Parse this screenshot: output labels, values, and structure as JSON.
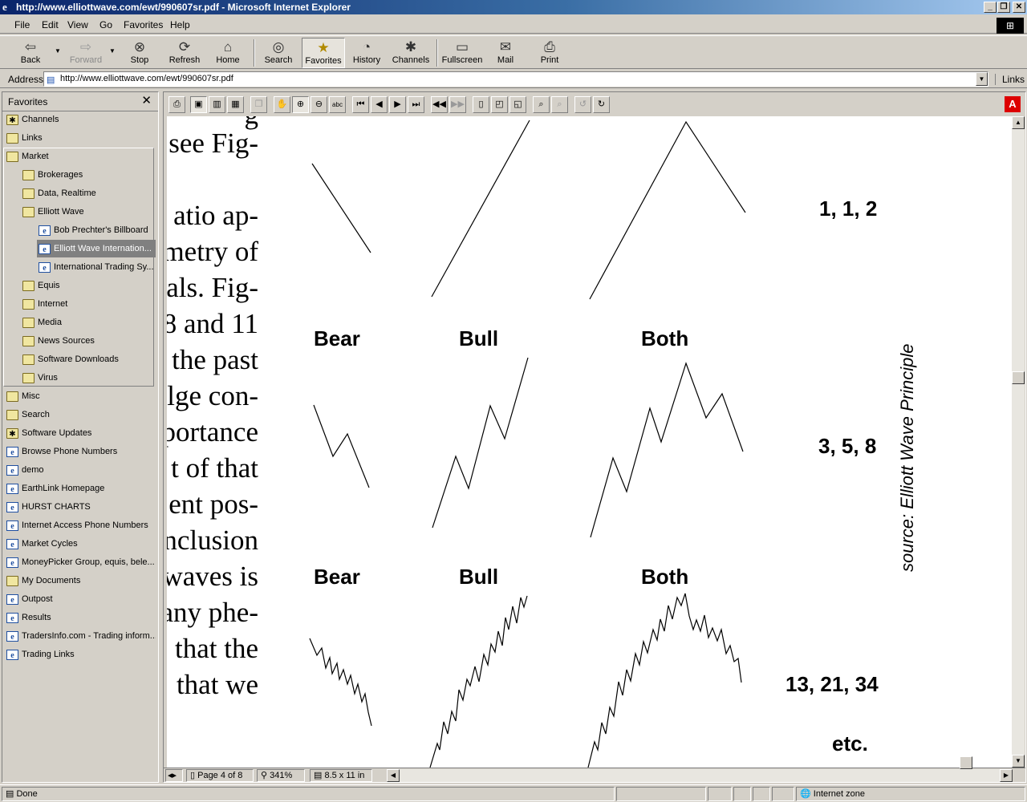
{
  "window": {
    "title": "http://www.elliottwave.com/ewt/990607sr.pdf - Microsoft Internet Explorer",
    "controls": [
      "_",
      "❐",
      "✕"
    ]
  },
  "menu": [
    "File",
    "Edit",
    "View",
    "Go",
    "Favorites",
    "Help"
  ],
  "toolbar": {
    "back": "Back",
    "forward": "Forward",
    "stop": "Stop",
    "refresh": "Refresh",
    "home": "Home",
    "search": "Search",
    "favorites": "Favorites",
    "history": "History",
    "channels": "Channels",
    "fullscreen": "Fullscreen",
    "mail": "Mail",
    "print": "Print"
  },
  "address": {
    "label": "Address",
    "url": "http://www.elliottwave.com/ewt/990607sr.pdf",
    "links": "Links"
  },
  "favorites": {
    "header": "Favorites",
    "items": [
      {
        "label": "Channels",
        "icon": "channel-folder"
      },
      {
        "label": "Links",
        "icon": "folder"
      },
      {
        "label": "Market",
        "icon": "folder-open"
      },
      {
        "label": "Brokerages",
        "icon": "folder"
      },
      {
        "label": "Data, Realtime",
        "icon": "folder"
      },
      {
        "label": "Elliott Wave",
        "icon": "folder-open"
      },
      {
        "label": "Bob Prechter's Billboard",
        "icon": "ie-page"
      },
      {
        "label": "Elliott Wave Internation...",
        "icon": "ie-page",
        "selected": true
      },
      {
        "label": "International Trading Sy...",
        "icon": "ie-page"
      },
      {
        "label": "Equis",
        "icon": "folder"
      },
      {
        "label": "Internet",
        "icon": "folder"
      },
      {
        "label": "Media",
        "icon": "folder"
      },
      {
        "label": "News Sources",
        "icon": "folder"
      },
      {
        "label": "Software Downloads",
        "icon": "folder"
      },
      {
        "label": "Virus",
        "icon": "folder"
      },
      {
        "label": "Misc",
        "icon": "folder"
      },
      {
        "label": "Search",
        "icon": "folder"
      },
      {
        "label": "Software Updates",
        "icon": "channel-folder"
      },
      {
        "label": "Browse Phone Numbers",
        "icon": "ie-page"
      },
      {
        "label": "demo",
        "icon": "ie-page"
      },
      {
        "label": "EarthLink Homepage",
        "icon": "ie-page"
      },
      {
        "label": "HURST CHARTS",
        "icon": "ie-page"
      },
      {
        "label": "Internet Access Phone Numbers",
        "icon": "ie-page"
      },
      {
        "label": "Market Cycles",
        "icon": "ie-page"
      },
      {
        "label": "MoneyPicker Group, equis, bele...",
        "icon": "ie-page"
      },
      {
        "label": "My Documents",
        "icon": "folder-special"
      },
      {
        "label": "Outpost",
        "icon": "ie-page"
      },
      {
        "label": "Results",
        "icon": "ie-page"
      },
      {
        "label": "TradersInfo.com - Trading inform...",
        "icon": "ie-page"
      },
      {
        "label": "Trading Links",
        "icon": "ie-page"
      }
    ]
  },
  "pdf": {
    "toolbar_icons": [
      "print-icon",
      "page-only-icon",
      "bookmarks-icon",
      "thumbnails-icon",
      "copy-icon",
      "hand-icon",
      "zoom-in-icon",
      "zoom-out-icon",
      "text-select-icon",
      "first-page-icon",
      "prev-page-icon",
      "next-page-icon",
      "last-page-icon",
      "go-back-icon",
      "go-forward-icon",
      "actual-size-icon",
      "fit-page-icon",
      "fit-width-icon",
      "find-icon",
      "find-again-icon",
      "rotate-left-icon",
      "rotate-right-icon",
      "acrobat-icon"
    ],
    "body_text": [
      "g",
      "see Fig-",
      "atio ap-",
      "metry of",
      "als. Fig-",
      "8 and 11",
      "the past",
      "lge con-",
      "portance",
      "t of that",
      "ent pos-",
      "nclusion",
      "waves is",
      "any phe-",
      "that the",
      "that we"
    ],
    "labels": {
      "bear": "Bear",
      "bull": "Bull",
      "both": "Both",
      "seq1": "1, 1, 2",
      "seq2": "3, 5, 8",
      "seq3": "13, 21, 34",
      "etc": "etc.",
      "source": "source: Elliott Wave Principle"
    },
    "status": {
      "page": "Page 4 of 8",
      "zoom": "341%",
      "size": "8.5 x 11 in"
    }
  },
  "status": {
    "text": "Done",
    "zone": "Internet zone"
  }
}
